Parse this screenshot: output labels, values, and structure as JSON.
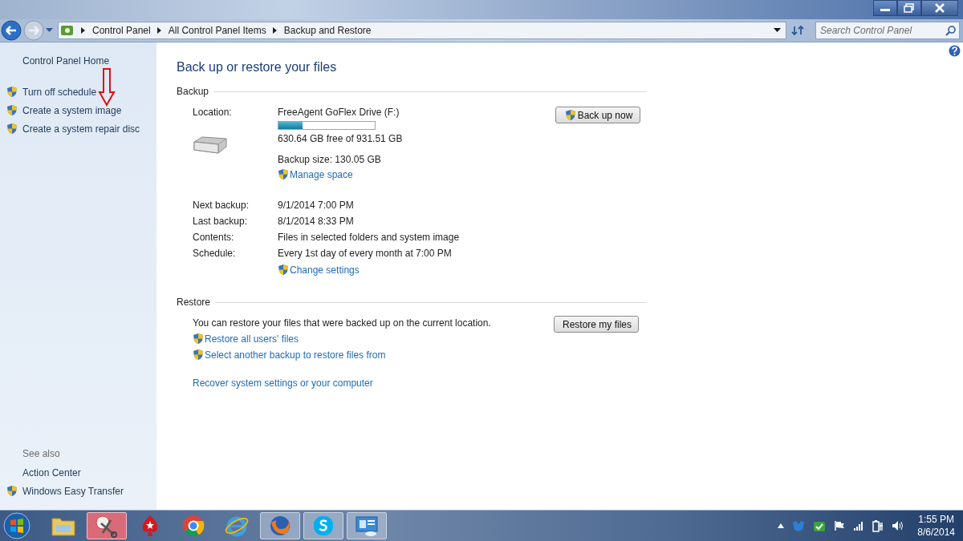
{
  "window": {
    "breadcrumb": [
      "Control Panel",
      "All Control Panel Items",
      "Backup and Restore"
    ],
    "search": {
      "placeholder": "Search Control Panel"
    }
  },
  "sidebar": {
    "home": "Control Panel Home",
    "tasks": [
      {
        "label": "Turn off schedule",
        "shield": true
      },
      {
        "label": "Create a system image",
        "shield": true
      },
      {
        "label": "Create a system repair disc",
        "shield": true
      }
    ],
    "see_also_title": "See also",
    "see_also": [
      {
        "label": "Action Center",
        "shield": false
      },
      {
        "label": "Windows Easy Transfer",
        "shield": true
      }
    ]
  },
  "title": "Back up or restore your files",
  "backup": {
    "heading": "Backup",
    "location_label": "Location:",
    "drive": "FreeAgent GoFlex Drive (F:)",
    "level": 0.25,
    "free": "630.64 GB free of 931.51 GB",
    "size": "Backup size: 130.05 GB",
    "manage_link": "Manage space",
    "button": "Back up now",
    "details": [
      {
        "label": "Next backup:",
        "value": "9/1/2014 7:00 PM"
      },
      {
        "label": "Last backup:",
        "value": "8/1/2014 8:33 PM"
      },
      {
        "label": "Contents:",
        "value": "Files in selected folders and system image"
      },
      {
        "label": "Schedule:",
        "value": "Every 1st day of every month at 7:00 PM"
      }
    ],
    "change_link": "Change settings"
  },
  "restore": {
    "heading": "Restore",
    "text": "You can restore your files that were backed up on the current location.",
    "button": "Restore my files",
    "links": [
      {
        "label": "Restore all users' files",
        "shield": true
      },
      {
        "label": "Select another backup to restore files from",
        "shield": true
      }
    ],
    "recover_link": "Recover system settings or your computer"
  },
  "taskbar": {
    "apps": [
      {
        "kind": "explorer",
        "running": false
      },
      {
        "kind": "scissors",
        "running": true
      },
      {
        "kind": "poker",
        "running": false
      },
      {
        "kind": "chrome",
        "running": false
      },
      {
        "kind": "ie",
        "running": false
      },
      {
        "kind": "firefox",
        "running": true
      },
      {
        "kind": "skype",
        "running": true
      },
      {
        "kind": "control-panel",
        "running": true
      }
    ],
    "clock": {
      "time": "1:55 PM",
      "date": "8/6/2014"
    }
  }
}
